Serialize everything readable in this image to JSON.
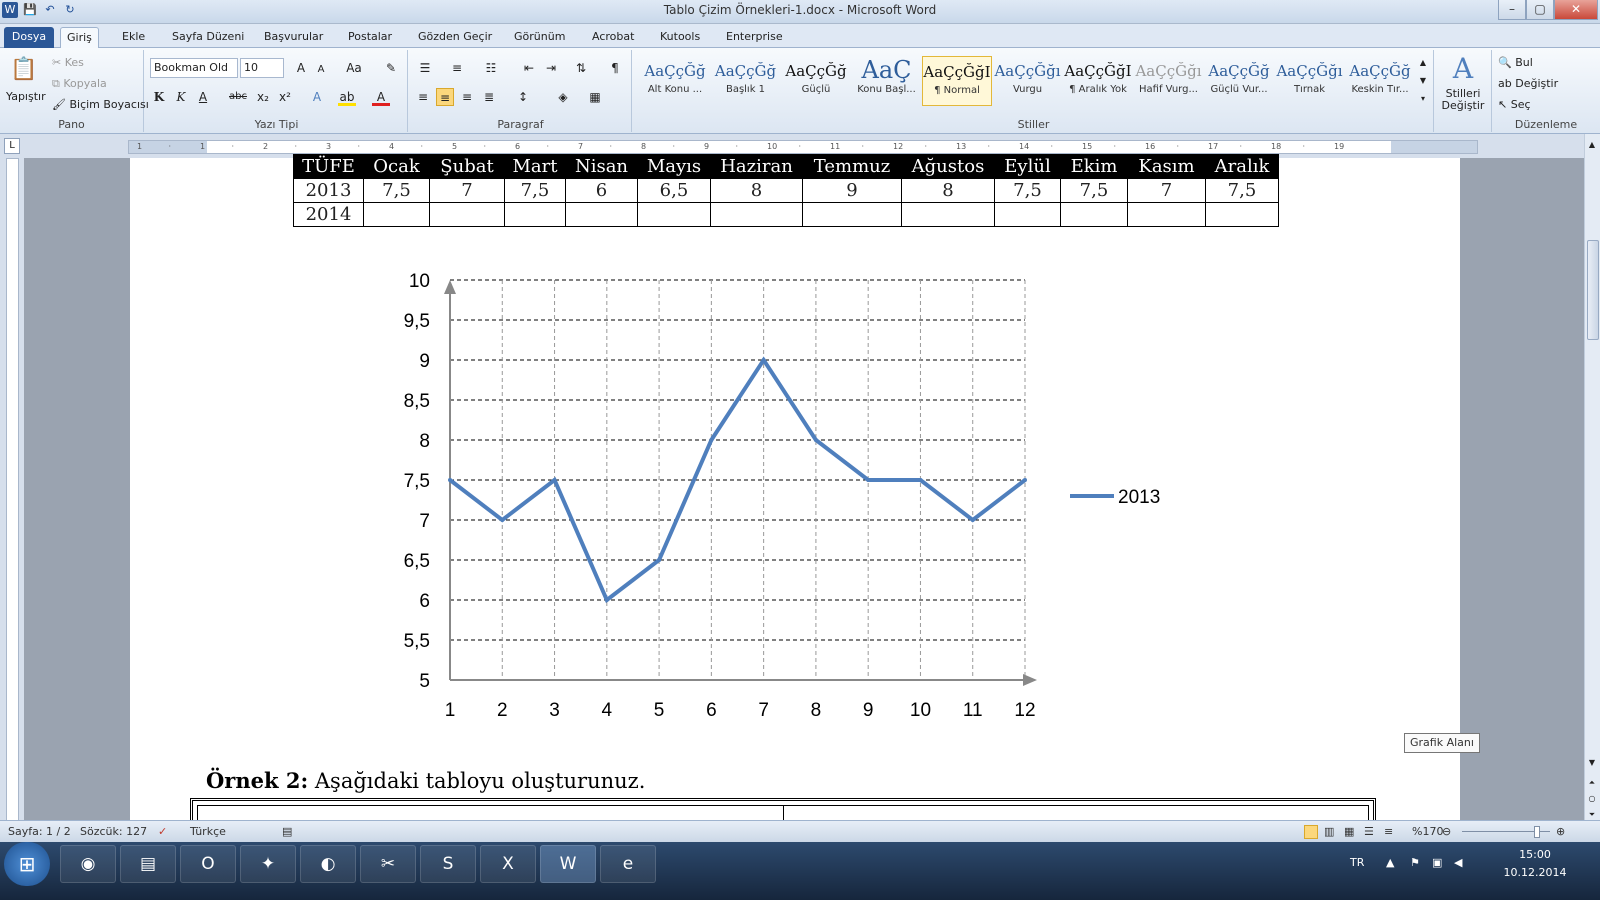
{
  "window": {
    "title": "Tablo Çizim Örnekleri-1.docx - Microsoft Word",
    "minimize": "–",
    "maximize": "▢",
    "close": "✕"
  },
  "qat": [
    "W",
    "💾",
    "↶",
    "↻"
  ],
  "tabs": [
    {
      "label": "Dosya"
    },
    {
      "label": "Giriş"
    },
    {
      "label": "Ekle"
    },
    {
      "label": "Sayfa Düzeni"
    },
    {
      "label": "Başvurular"
    },
    {
      "label": "Postalar"
    },
    {
      "label": "Gözden Geçir"
    },
    {
      "label": "Görünüm"
    },
    {
      "label": "Acrobat"
    },
    {
      "label": "Kutools"
    },
    {
      "label": "Enterprise"
    }
  ],
  "ribbon": {
    "clipboard": {
      "paste": "Yapıştır",
      "cut": "Kes",
      "copy": "Kopyala",
      "painter": "Biçim Boyacısı",
      "label": "Pano"
    },
    "font": {
      "name": "Bookman Old",
      "size": "10",
      "label": "Yazı Tipi",
      "bold": "K",
      "italic": "K",
      "underline": "A",
      "strike": "abc",
      "sub": "x₂",
      "sup": "x²",
      "grow": "A",
      "shrink": "A",
      "case": "Aa"
    },
    "paragraph": {
      "label": "Paragraf",
      "pilcrow": "¶"
    },
    "styles": {
      "label": "Stiller",
      "items": [
        {
          "preview": "AaÇçĞğ",
          "name": "Alt Konu ..."
        },
        {
          "preview": "AaÇçĞğ",
          "name": "Başlık 1"
        },
        {
          "preview": "AaÇçĞğ",
          "name": "Güçlü"
        },
        {
          "preview": "AaÇ",
          "name": "Konu Başl..."
        },
        {
          "preview": "AaÇçĞğI",
          "name": "¶ Normal"
        },
        {
          "preview": "AaÇçĞğı",
          "name": "Vurgu"
        },
        {
          "preview": "AaÇçĞğI",
          "name": "¶ Aralık Yok"
        },
        {
          "preview": "AaÇçĞğı",
          "name": "Hafif Vurg..."
        },
        {
          "preview": "AaÇçĞğ",
          "name": "Güçlü Vur..."
        },
        {
          "preview": "AaÇçĞğı",
          "name": "Tırnak"
        },
        {
          "preview": "AaÇçĞğ",
          "name": "Keskin Tır..."
        }
      ],
      "change": "Stilleri Değiştir"
    },
    "editing": {
      "label": "Düzenleme",
      "find": "Bul",
      "replace": "Değiştir",
      "select": "Seç"
    }
  },
  "ruler_numbers": [
    "1",
    "·",
    "1",
    "·",
    "2",
    "·",
    "3",
    "·",
    "4",
    "·",
    "5",
    "·",
    "6",
    "·",
    "7",
    "·",
    "8",
    "·",
    "9",
    "·",
    "10",
    "·",
    "11",
    "·",
    "12",
    "·",
    "13",
    "·",
    "14",
    "·",
    "15",
    "·",
    "16",
    "·",
    "17",
    "·",
    "18",
    "·",
    "19"
  ],
  "table": {
    "headers": [
      "TÜFE",
      "Ocak",
      "Şubat",
      "Mart",
      "Nisan",
      "Mayıs",
      "Haziran",
      "Temmuz",
      "Ağustos",
      "Eylül",
      "Ekim",
      "Kasım",
      "Aralık"
    ],
    "rows": [
      [
        "2013",
        "7,5",
        "7",
        "7,5",
        "6",
        "6,5",
        "8",
        "9",
        "8",
        "7,5",
        "7,5",
        "7",
        "7,5"
      ],
      [
        "2014",
        "",
        "",
        "",
        "",
        "",
        "",
        "",
        "",
        "",
        "",
        "",
        ""
      ]
    ]
  },
  "chart_data": {
    "type": "line",
    "x": [
      1,
      2,
      3,
      4,
      5,
      6,
      7,
      8,
      9,
      10,
      11,
      12
    ],
    "series": [
      {
        "name": "2013",
        "values": [
          7.5,
          7,
          7.5,
          6,
          6.5,
          8,
          9,
          8,
          7.5,
          7.5,
          7,
          7.5
        ],
        "color": "#4f7fbd"
      }
    ],
    "ylim": [
      5,
      10
    ],
    "yticks": [
      "5",
      "5,5",
      "6",
      "6,5",
      "7",
      "7,5",
      "8",
      "8,5",
      "9",
      "9,5",
      "10"
    ],
    "xticks": [
      "1",
      "2",
      "3",
      "4",
      "5",
      "6",
      "7",
      "8",
      "9",
      "10",
      "11",
      "12"
    ],
    "grid": true,
    "legend": "right"
  },
  "example2": {
    "title": "Örnek 2:",
    "text": " Aşağıdaki tabloyu oluşturunuz."
  },
  "tooltip": "Grafik Alanı",
  "status": {
    "page": "Sayfa: 1 / 2",
    "words": "Sözcük: 127",
    "lang": "Türkçe",
    "zoom": "%170"
  },
  "tray": {
    "lang": "TR",
    "time": "15:00",
    "date": "10.12.2014"
  },
  "taskbar": [
    {
      "icon": "chrome-icon",
      "glyph": "◉"
    },
    {
      "icon": "explorer-icon",
      "glyph": "▤"
    },
    {
      "icon": "outlook-icon",
      "glyph": "O"
    },
    {
      "icon": "app-icon",
      "glyph": "✦"
    },
    {
      "icon": "sync-icon",
      "glyph": "◐"
    },
    {
      "icon": "tool-icon",
      "glyph": "✂"
    },
    {
      "icon": "skype-icon",
      "glyph": "S"
    },
    {
      "icon": "excel-icon",
      "glyph": "X"
    },
    {
      "icon": "word-icon",
      "glyph": "W"
    },
    {
      "icon": "ie-icon",
      "glyph": "e"
    }
  ]
}
